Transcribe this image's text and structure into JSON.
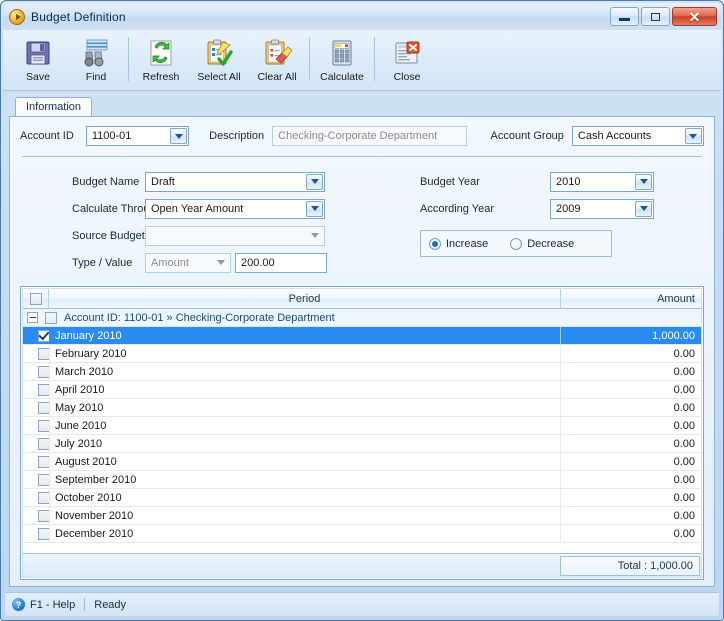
{
  "window": {
    "title": "Budget Definition",
    "icon": "play-circle-icon",
    "buttons": {
      "minimize": "minimize-icon",
      "maximize": "maximize-icon",
      "close": "✕"
    }
  },
  "toolbar": {
    "items": [
      {
        "label": "Save",
        "icon": "floppy-disk-icon"
      },
      {
        "label": "Find",
        "icon": "binoculars-icon"
      },
      {
        "label": "Refresh",
        "icon": "refresh-arrows-icon"
      },
      {
        "label": "Select All",
        "icon": "clipboard-check-icon"
      },
      {
        "label": "Clear All",
        "icon": "clipboard-eraser-icon"
      },
      {
        "label": "Calculate",
        "icon": "calculator-icon"
      },
      {
        "label": "Close",
        "icon": "document-close-icon"
      }
    ]
  },
  "tabs": [
    {
      "label": "Information",
      "active": true
    }
  ],
  "header_row": {
    "account_id_label": "Account ID",
    "account_id_value": "1100-01",
    "description_label": "Description",
    "description_value": "Checking-Corporate Department",
    "account_group_label": "Account Group",
    "account_group_value": "Cash Accounts"
  },
  "form": {
    "left": [
      {
        "label": "Budget Name",
        "value": "Draft",
        "type": "combo",
        "enabled": true
      },
      {
        "label": "Calculate Through",
        "value": "Open Year Amount",
        "type": "combo",
        "enabled": true
      },
      {
        "label": "Source Budget",
        "value": "",
        "type": "combo",
        "enabled": false
      },
      {
        "label": "Type / Value",
        "value": "Amount",
        "type": "combo-pair",
        "enabled": false,
        "second_value": "200.00"
      }
    ],
    "right": [
      {
        "label": "Budget Year",
        "value": "2010",
        "type": "combo",
        "enabled": true
      },
      {
        "label": "According Year",
        "value": "2009",
        "type": "combo",
        "enabled": true
      }
    ],
    "direction": {
      "increase_label": "Increase",
      "decrease_label": "Decrease",
      "selected": "Increase"
    }
  },
  "grid": {
    "columns": {
      "check": "",
      "period": "Period",
      "amount": "Amount"
    },
    "group_row": {
      "label": "Account ID: 1100-01 » Checking-Corporate Department",
      "expanded": true
    },
    "rows": [
      {
        "period": "January 2010",
        "amount": "1,000.00",
        "checked": true,
        "selected": true
      },
      {
        "period": "February 2010",
        "amount": "0.00",
        "checked": false,
        "selected": false
      },
      {
        "period": "March 2010",
        "amount": "0.00",
        "checked": false,
        "selected": false
      },
      {
        "period": "April 2010",
        "amount": "0.00",
        "checked": false,
        "selected": false
      },
      {
        "period": "May 2010",
        "amount": "0.00",
        "checked": false,
        "selected": false
      },
      {
        "period": "June 2010",
        "amount": "0.00",
        "checked": false,
        "selected": false
      },
      {
        "period": "July 2010",
        "amount": "0.00",
        "checked": false,
        "selected": false
      },
      {
        "period": "August 2010",
        "amount": "0.00",
        "checked": false,
        "selected": false
      },
      {
        "period": "September 2010",
        "amount": "0.00",
        "checked": false,
        "selected": false
      },
      {
        "period": "October 2010",
        "amount": "0.00",
        "checked": false,
        "selected": false
      },
      {
        "period": "November 2010",
        "amount": "0.00",
        "checked": false,
        "selected": false
      },
      {
        "period": "December 2010",
        "amount": "0.00",
        "checked": false,
        "selected": false
      }
    ],
    "total": "Total : 1,000.00"
  },
  "statusbar": {
    "help": "F1 - Help",
    "state": "Ready"
  },
  "colors": {
    "selection_blue": "#2a8bf0",
    "accent_border": "#7da7cd",
    "close_red": "#c8402a",
    "group_text": "#1a4b80"
  }
}
